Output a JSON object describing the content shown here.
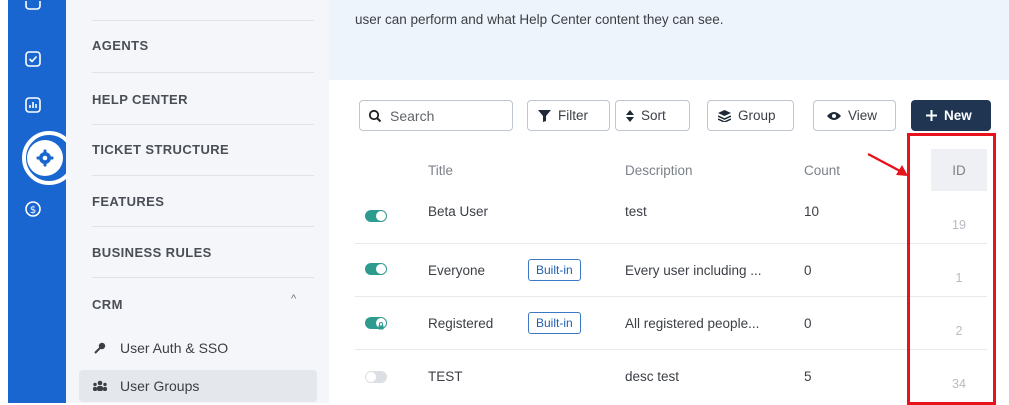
{
  "rail": {
    "icons": [
      "chat-icon",
      "check-square-icon",
      "chart-icon",
      "gear-icon",
      "dollar-icon"
    ]
  },
  "sidebar": {
    "sections": [
      {
        "label": "AGENTS"
      },
      {
        "label": "HELP CENTER"
      },
      {
        "label": "TICKET STRUCTURE"
      },
      {
        "label": "FEATURES"
      },
      {
        "label": "BUSINESS RULES"
      },
      {
        "label": "CRM"
      }
    ],
    "crm_caret": "^",
    "items": [
      {
        "label": "User Auth & SSO",
        "icon": "key-icon"
      },
      {
        "label": "User Groups",
        "icon": "users-icon",
        "active": true
      }
    ]
  },
  "banner": {
    "text": "user can perform and what Help Center content they can see."
  },
  "toolbar": {
    "search_placeholder": "Search",
    "filter_label": "Filter",
    "sort_label": "Sort",
    "group_label": "Group",
    "view_label": "View",
    "new_label": "New"
  },
  "table": {
    "headers": {
      "title": "Title",
      "description": "Description",
      "count": "Count",
      "id": "ID"
    },
    "rows": [
      {
        "enabled": true,
        "locked": false,
        "title": "Beta User",
        "badge": "",
        "description": "test",
        "count": "10",
        "id": "19"
      },
      {
        "enabled": true,
        "locked": false,
        "title": "Everyone",
        "badge": "Built-in",
        "description": "Every user including ...",
        "count": "0",
        "id": "1"
      },
      {
        "enabled": true,
        "locked": true,
        "title": "Registered",
        "badge": "Built-in",
        "description": "All registered people...",
        "count": "0",
        "id": "2"
      },
      {
        "enabled": false,
        "locked": false,
        "title": "TEST",
        "badge": "",
        "description": "desc test",
        "count": "5",
        "id": "34"
      }
    ]
  },
  "colors": {
    "rail": "#1a66d1",
    "toggle_on": "#2e9b8f",
    "new_button": "#1f3552",
    "badge": "#3c78c5",
    "annotation": "#e8121c"
  }
}
